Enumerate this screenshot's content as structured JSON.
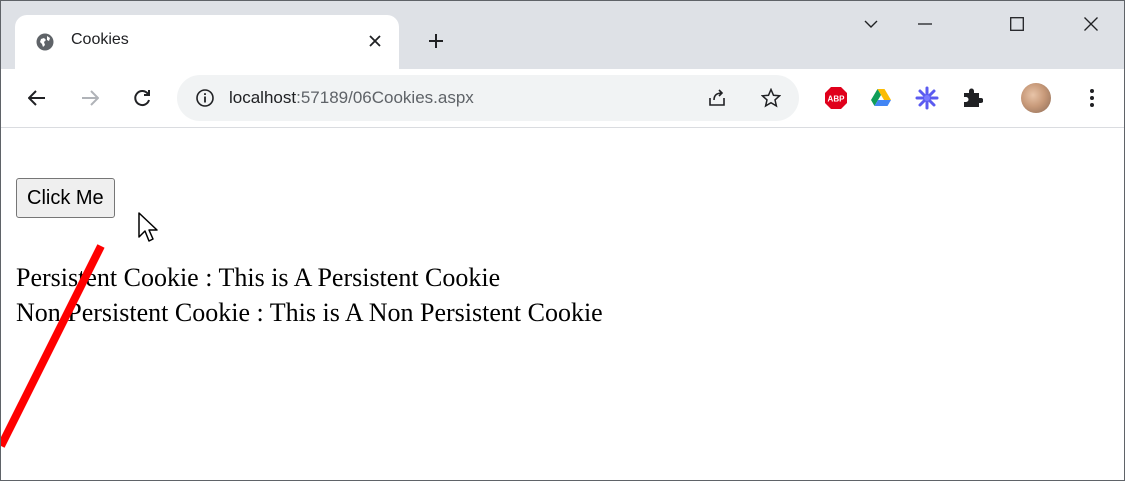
{
  "browser": {
    "tab": {
      "title": "Cookies"
    },
    "address": {
      "host": "localhost",
      "path": ":57189/06Cookies.aspx"
    },
    "extensions": [
      "adblock-plus-icon",
      "google-drive-icon",
      "sparkle-extension-icon",
      "puzzle-extensions-icon"
    ],
    "colors": {
      "abp_red": "#e0001b",
      "tab_strip": "#dee1e6",
      "annotation_red": "#ff0000"
    }
  },
  "page": {
    "button_label": "Click Me",
    "lines": [
      "Persistent Cookie : This is A Persistent Cookie",
      "Non Persistent Cookie : This is A Non Persistent Cookie"
    ]
  }
}
